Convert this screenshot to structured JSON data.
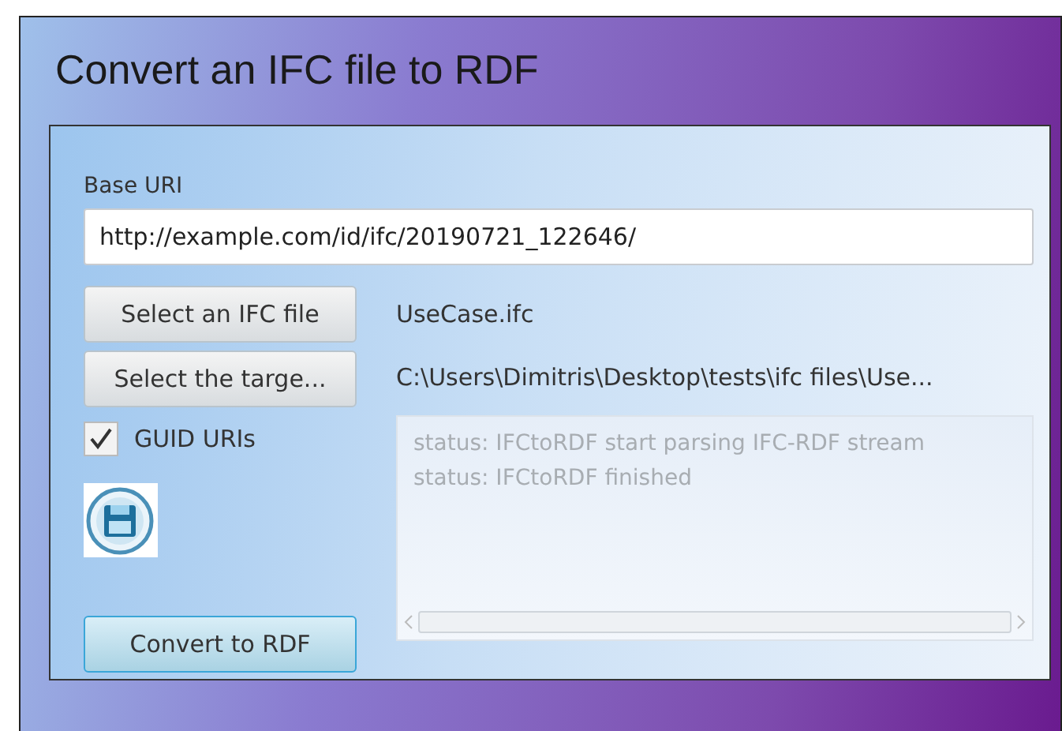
{
  "window": {
    "title": "Convert an IFC file to RDF"
  },
  "base_uri": {
    "label": "Base URI",
    "value": "http://example.com/id/ifc/20190721_122646/"
  },
  "buttons": [
    {
      "label": "Select an IFC file",
      "focused": false
    },
    {
      "label": "Select the targe...",
      "focused": false
    }
  ],
  "files": [
    "UseCase.ifc",
    "C:\\Users\\Dimitris\\Desktop\\tests\\ifc files\\Use..."
  ],
  "guid_uris": {
    "label": "GUID URIs",
    "checked": true
  },
  "log": [
    "status: IFCtoRDF start parsing IFC-RDF stream",
    "status: IFCtoRDF finished"
  ],
  "convert_button": {
    "label": "Convert to RDF",
    "focused": true
  }
}
